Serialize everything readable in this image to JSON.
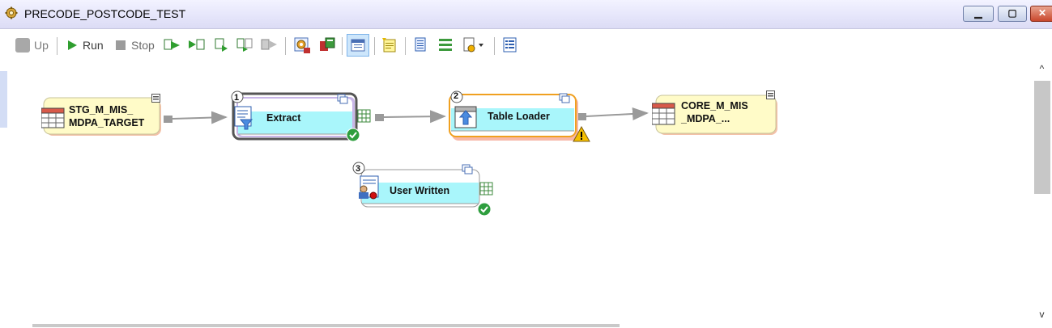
{
  "window": {
    "title": "PRECODE_POSTCODE_TEST",
    "minimize_glyph": "▁",
    "maximize_glyph": "▢",
    "close_glyph": "✕"
  },
  "toolbar": {
    "up_label": "Up",
    "run_label": "Run",
    "stop_label": "Stop"
  },
  "diagram": {
    "nodes": [
      {
        "id": "source",
        "kind": "table",
        "line1": "STG_M_MIS_",
        "line2": "MDPA_TARGET"
      },
      {
        "id": "extract",
        "kind": "transform",
        "step": "1",
        "label": "Extract",
        "status": "success"
      },
      {
        "id": "table_loader",
        "kind": "transform",
        "step": "2",
        "label": "Table Loader",
        "status": "warning"
      },
      {
        "id": "target",
        "kind": "table",
        "line1": "CORE_M_MIS",
        "line2": "_MDPA_..."
      },
      {
        "id": "user_written",
        "kind": "transform",
        "step": "3",
        "label": "User Written",
        "status": "success"
      }
    ]
  },
  "scrollbar": {
    "up_glyph": "^",
    "down_glyph": "v"
  },
  "colors": {
    "table_node_fill": "#fffbc8",
    "transform_fill": "#a9f6fb",
    "title_bar": "#e6e6fb",
    "success": "#2e9e3e",
    "warning": "#f5c000",
    "connector": "#9a9a9a"
  }
}
